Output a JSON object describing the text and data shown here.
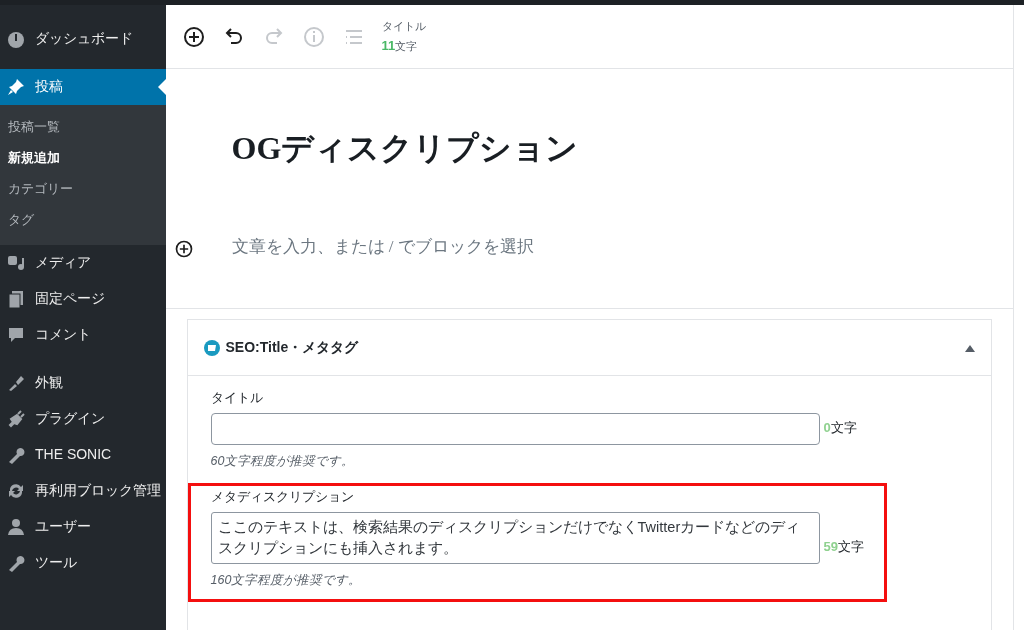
{
  "sidebar": {
    "items": [
      {
        "label": "ダッシュボード",
        "selected": false
      },
      {
        "label": "投稿",
        "selected": true,
        "children": [
          {
            "label": "投稿一覧",
            "selected": false
          },
          {
            "label": "新規追加",
            "selected": true
          },
          {
            "label": "カテゴリー",
            "selected": false
          },
          {
            "label": "タグ",
            "selected": false
          }
        ]
      },
      {
        "label": "メディア",
        "selected": false
      },
      {
        "label": "固定ページ",
        "selected": false
      },
      {
        "label": "コメント",
        "selected": false
      },
      {
        "label": "外観",
        "selected": false
      },
      {
        "label": "プラグイン",
        "selected": false
      },
      {
        "label": "THE SONIC",
        "selected": false
      },
      {
        "label": "再利用ブロック管理",
        "selected": false
      },
      {
        "label": "ユーザー",
        "selected": false
      },
      {
        "label": "ツール",
        "selected": false
      }
    ]
  },
  "toolbar": {
    "tools": [
      {
        "kind": "add",
        "disabled": false
      },
      {
        "kind": "undo",
        "disabled": false
      },
      {
        "kind": "redo",
        "disabled": true
      },
      {
        "kind": "info",
        "disabled": true
      },
      {
        "kind": "outline",
        "disabled": true
      }
    ],
    "counter": {
      "label": "タイトル",
      "count": "11",
      "unit": "文字"
    }
  },
  "editor": {
    "title": "OGディスクリプション",
    "paragraph_placeholder": "文章を入力、または / でブロックを選択"
  },
  "panel": {
    "title": "SEO:Title・メタタグ",
    "expanded": true,
    "fields": [
      {
        "kind": "input",
        "label": "タイトル",
        "count": "0",
        "unit": "文字",
        "hint": "60文字程度が推奨です。",
        "highlighted": false
      },
      {
        "kind": "textarea",
        "label": "メタディスクリプション",
        "value": "ここのテキストは、検索結果のディスクリプションだけでなくTwitterカードなどのディスクリプションにも挿入されます。",
        "count": "59",
        "unit": "文字",
        "hint": "160文字程度が推奨です。",
        "highlighted": true
      }
    ]
  }
}
